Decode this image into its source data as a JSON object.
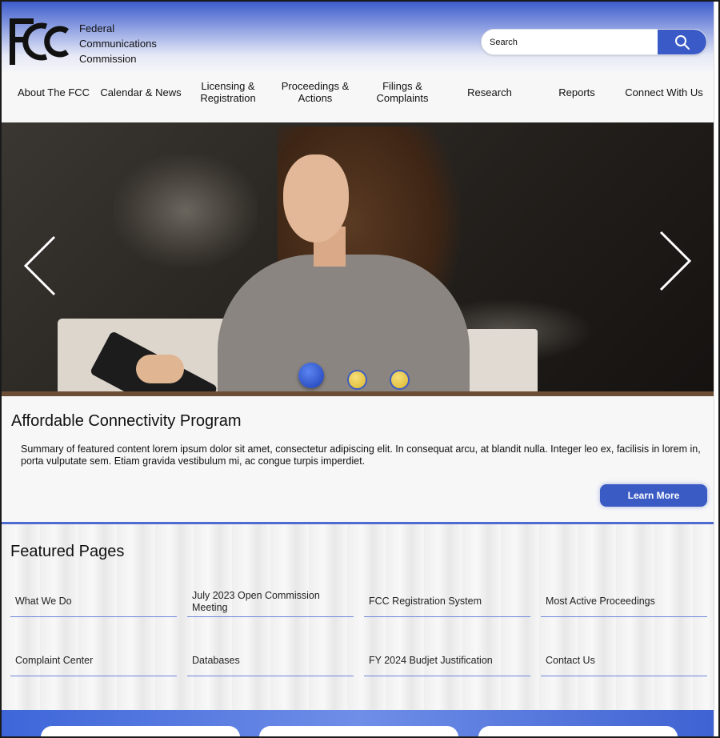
{
  "header": {
    "logo_text": "FCC",
    "agency_lines": [
      "Federal",
      "Communications",
      "Commission"
    ],
    "search": {
      "placeholder": "Search",
      "button_icon": "search-icon"
    }
  },
  "nav": {
    "items": [
      {
        "label": "About The FCC"
      },
      {
        "label": "Calendar & News"
      },
      {
        "label": "Licensing & Registration"
      },
      {
        "label": "Proceedings & Actions"
      },
      {
        "label": "Filings & Complaints"
      },
      {
        "label": "Research"
      },
      {
        "label": "Reports"
      },
      {
        "label": "Connect With Us"
      }
    ]
  },
  "hero": {
    "prev_icon": "chevron-left-icon",
    "next_icon": "chevron-right-icon",
    "slides_total": 3,
    "active_slide": 1,
    "colors": {
      "active_dot": "#2f53c7",
      "inactive_dot": "#e2c13f"
    }
  },
  "featured": {
    "title": "Affordable Connectivity Program",
    "summary": "Summary of featured content lorem ipsum dolor sit amet, consectetur adipiscing elit. In consequat arcu, at blandit nulla. Integer leo ex, facilisis in lorem in, porta vulputate sem. Etiam gravida vestibulum mi, ac congue turpis imperdiet.",
    "button_label": "Learn More"
  },
  "featured_pages": {
    "title": "Featured Pages",
    "links": [
      {
        "label": "What We Do"
      },
      {
        "label": "July 2023 Open Commission Meeting"
      },
      {
        "label": "FCC Registration System"
      },
      {
        "label": "Most Active Proceedings"
      },
      {
        "label": "Complaint Center"
      },
      {
        "label": "Databases"
      },
      {
        "label": "FY 2024 Budjet Justification"
      },
      {
        "label": "Contact Us"
      }
    ]
  },
  "colors": {
    "accent": "#3b5bc4",
    "header_top": "#3d5ccc"
  }
}
